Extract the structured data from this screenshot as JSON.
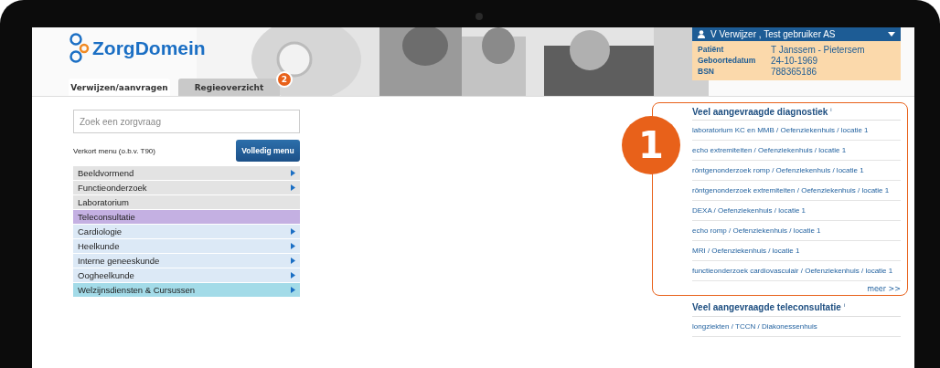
{
  "logo": {
    "text": "ZorgDomein"
  },
  "tabs": [
    {
      "label": "Verwijzen/aanvragen",
      "selected": true
    },
    {
      "label": "Regieoverzicht",
      "selected": false
    }
  ],
  "tab_badge": "2",
  "user_menu": {
    "name": "V Verwijzer , Test gebruiker AS"
  },
  "patient": [
    {
      "label": "Patiënt",
      "value": "T Janssem - Pietersem"
    },
    {
      "label": "Geboortedatum",
      "value": "24-10-1969"
    },
    {
      "label": "BSN",
      "value": "788365186"
    }
  ],
  "search": {
    "placeholder": "Zoek een zorgvraag"
  },
  "menu_caption": "Verkort menu (o.b.v. T90)",
  "full_menu_button": "Volledig menu",
  "menu": [
    {
      "label": "Beeldvormend",
      "color": "#e3e3e3",
      "expandable": true
    },
    {
      "label": "Functieonderzoek",
      "color": "#e3e3e3",
      "expandable": true
    },
    {
      "label": "Laboratorium",
      "color": "#e3e3e3",
      "expandable": false
    },
    {
      "label": "Teleconsultatie",
      "color": "#c4b0e2",
      "expandable": false
    },
    {
      "label": "Cardiologie",
      "color": "#dce9f6",
      "expandable": true
    },
    {
      "label": "Heelkunde",
      "color": "#dce9f6",
      "expandable": true
    },
    {
      "label": "Interne geneeskunde",
      "color": "#dce9f6",
      "expandable": true
    },
    {
      "label": "Oogheelkunde",
      "color": "#dce9f6",
      "expandable": true
    },
    {
      "label": "Welzijnsdiensten & Cursussen",
      "color": "#a3dbe8",
      "expandable": true
    }
  ],
  "panels": [
    {
      "title": "Veel aangevraagde diagnostiek $^{i}$",
      "highlighted": true,
      "badge": "1",
      "links": [
        "laboratorium KC en MMB / Oefenziekenhuis / locatie 1",
        "echo extremiteiten / Oefenziekenhuis / locatie 1",
        "röntgenonderzoek romp / Oefenziekenhuis / locatie 1",
        "röntgenonderzoek extremiteiten / Oefenziekenhuis / locatie 1",
        "DEXA / Oefenziekenhuis / locatie 1",
        "echo romp / Oefenziekenhuis / locatie 1",
        "MRI / Oefenziekenhuis / locatie 1",
        "functieonderzoek cardiovasculair / Oefenziekenhuis / locatie 1"
      ],
      "more": "meer >>"
    },
    {
      "title": "Veel aangevraagde teleconsultatie $^{i}$",
      "highlighted": false,
      "links": [
        "longziekten / TCCN / Diakonessenhuis"
      ]
    }
  ]
}
